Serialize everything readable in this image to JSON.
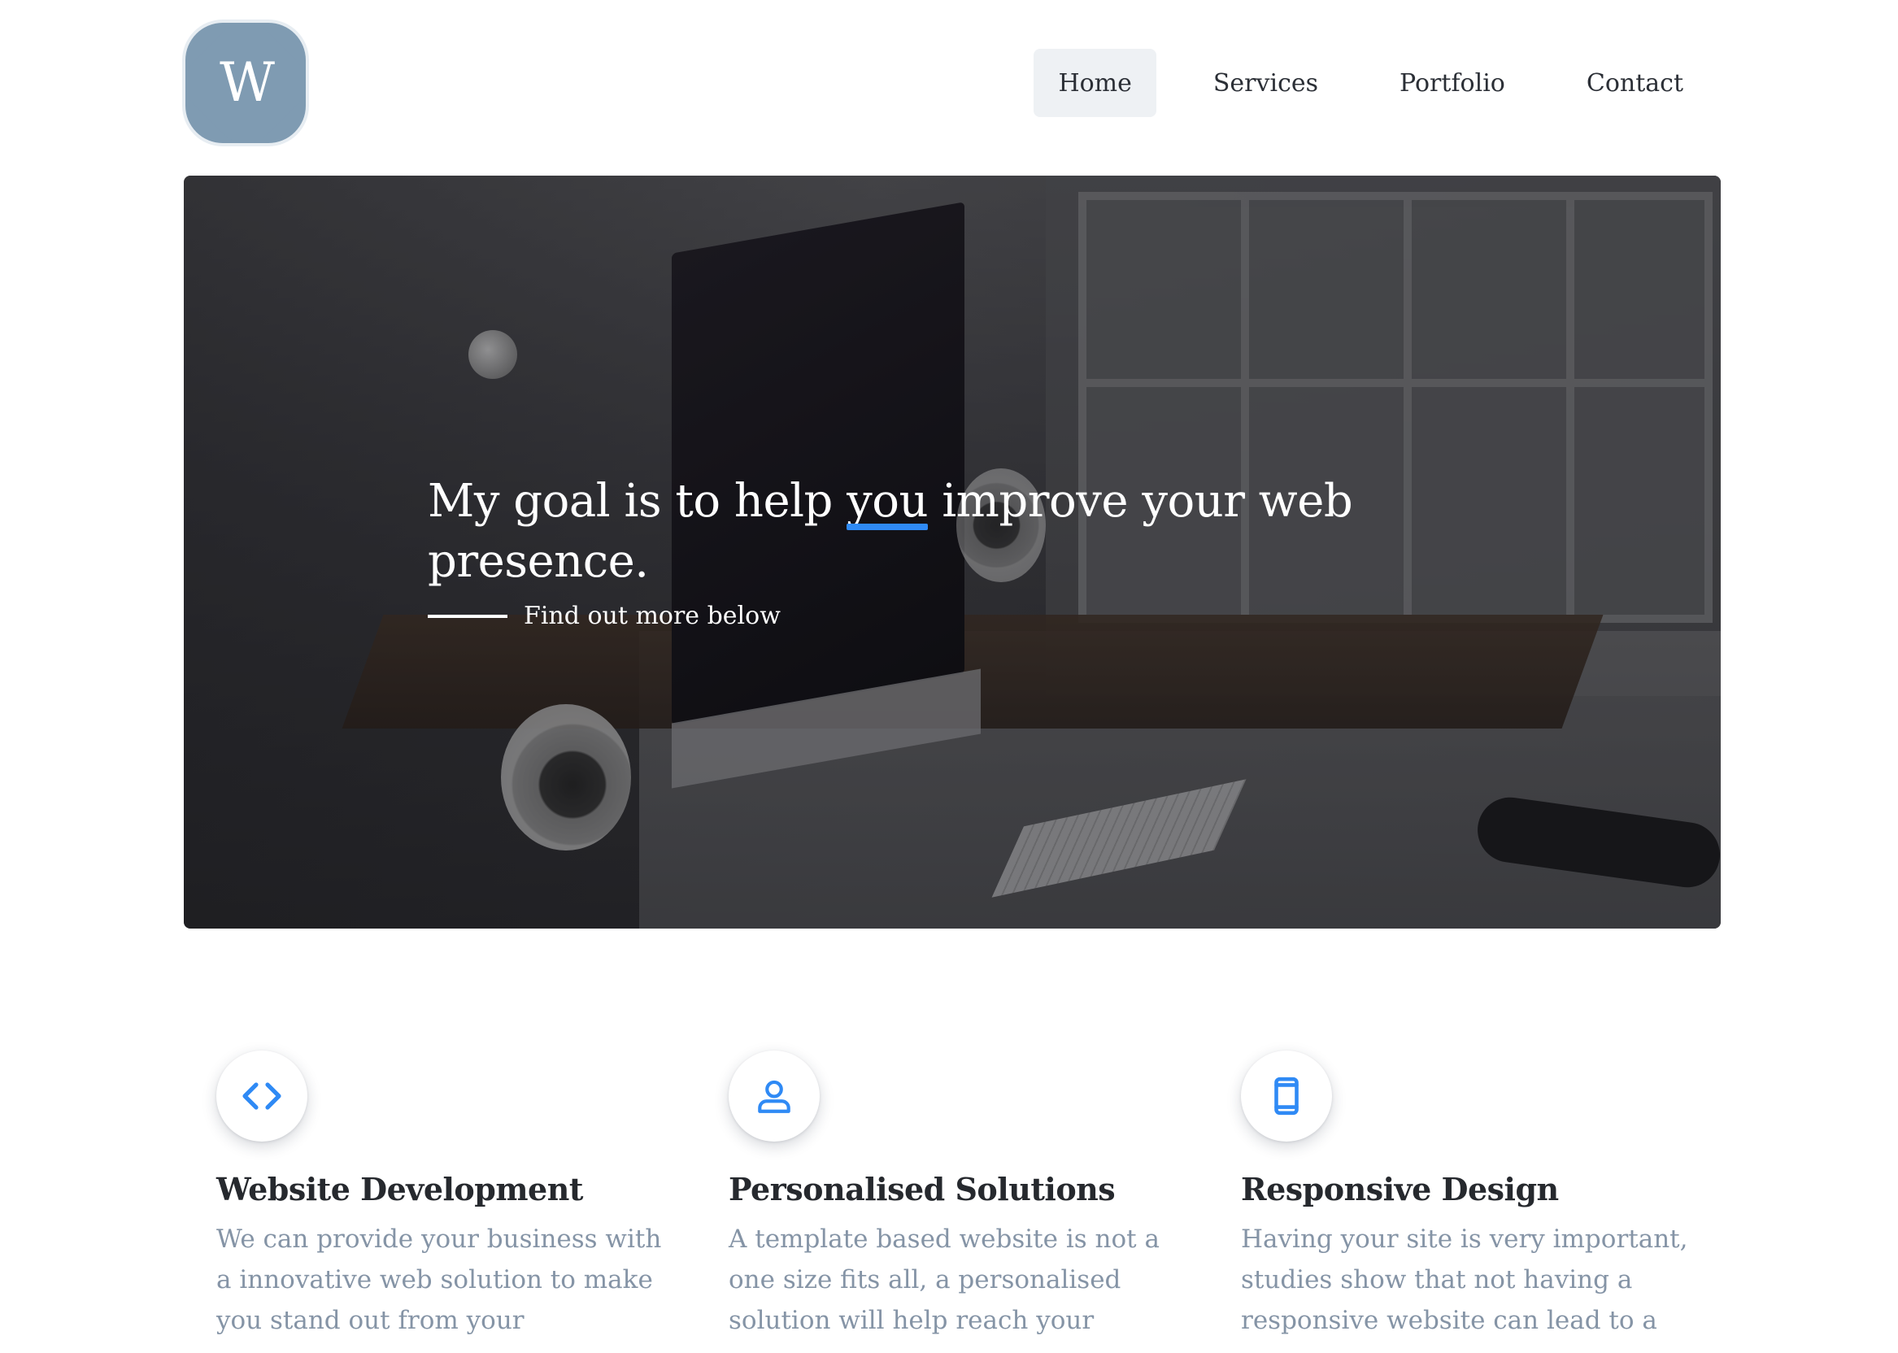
{
  "brand": {
    "logo_letter": "W"
  },
  "nav": {
    "items": [
      {
        "label": "Home",
        "active": true
      },
      {
        "label": "Services",
        "active": false
      },
      {
        "label": "Portfolio",
        "active": false
      },
      {
        "label": "Contact",
        "active": false
      }
    ]
  },
  "hero": {
    "headline_before": "My goal is to help ",
    "headline_highlight": "you",
    "headline_after": " improve your web presence.",
    "cta_label": "Find out more below",
    "accent_color": "#2f8af5"
  },
  "features": [
    {
      "icon": "code-icon",
      "title": "Website Development",
      "description": "We can provide your business with a innovative web solution to make you stand out from your"
    },
    {
      "icon": "user-icon",
      "title": "Personalised Solutions",
      "description": "A template based website is not a one size fits all, a personalised solution will help reach your"
    },
    {
      "icon": "mobile-icon",
      "title": "Responsive Design",
      "description": "Having your site is very important, studies show that not having a responsive website can lead to a"
    }
  ],
  "colors": {
    "logo_bg": "#7f9bb2",
    "icon_blue": "#2f8af5",
    "feature_title": "#26292e",
    "feature_text": "#8594a6",
    "nav_active_bg": "#eef1f4"
  }
}
